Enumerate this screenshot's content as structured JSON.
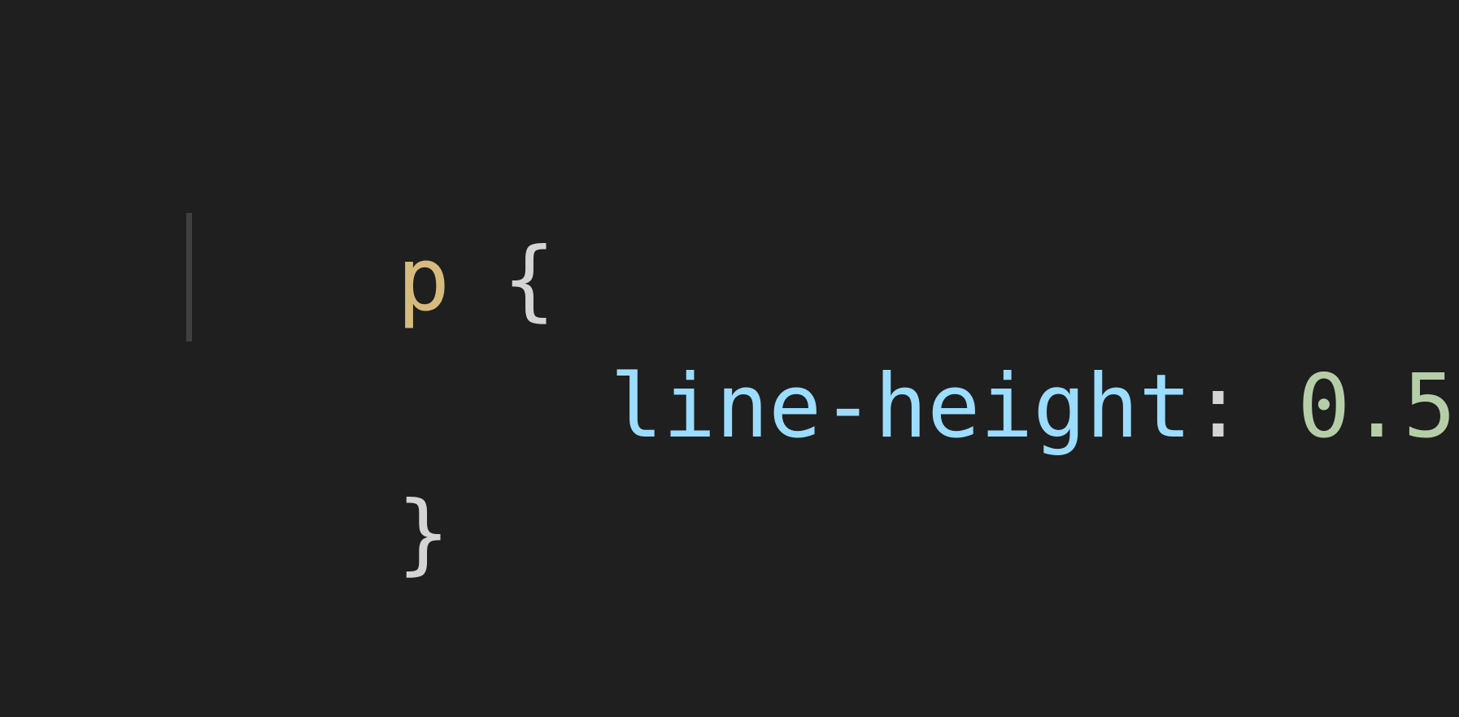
{
  "editor": {
    "lines": [
      {
        "tokens": [
          {
            "text": "p",
            "type": "selector"
          },
          {
            "text": " ",
            "type": "space"
          },
          {
            "text": "{",
            "type": "brace"
          }
        ]
      },
      {
        "tokens": [
          {
            "text": "line-height",
            "type": "property"
          },
          {
            "text": ": ",
            "type": "punct"
          },
          {
            "text": "0.5",
            "type": "number"
          },
          {
            "text": ";",
            "type": "punct"
          }
        ]
      },
      {
        "tokens": [
          {
            "text": "}",
            "type": "brace"
          }
        ]
      }
    ]
  },
  "colors": {
    "background": "#1f1f1f",
    "selector": "#d7ba7d",
    "brace": "#d4d4d4",
    "property": "#9cdcfe",
    "number": "#b5cea8",
    "punctuation": "#d4d4d4",
    "indent_guide": "#404040"
  }
}
